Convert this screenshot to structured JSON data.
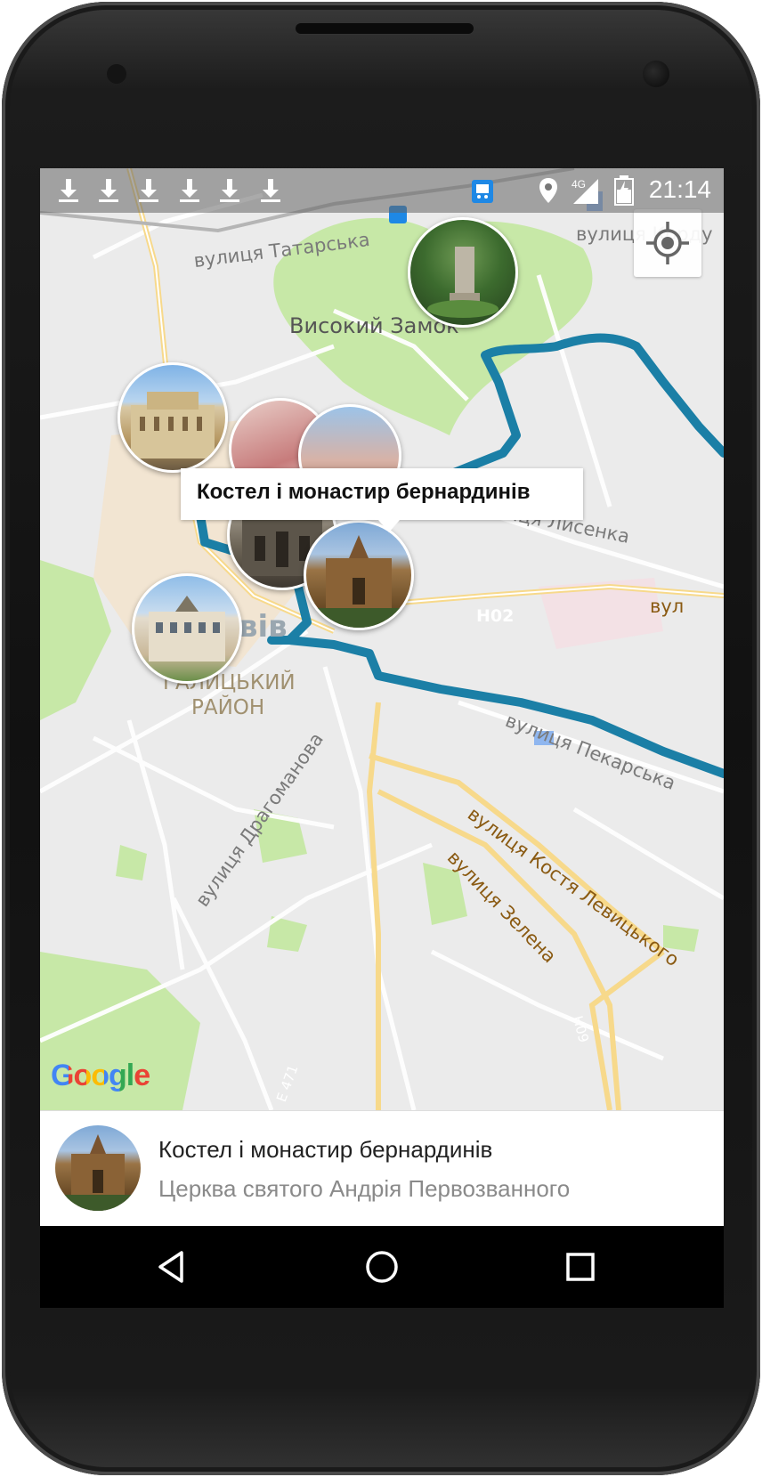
{
  "status_bar": {
    "time": "21:14",
    "network": "4G",
    "download_icons": [
      "download-icon",
      "download-icon",
      "download-icon",
      "download-icon",
      "download-icon",
      "download-icon"
    ]
  },
  "map": {
    "labels": {
      "street_tatarska": "вулиця Татарська",
      "street_kordu": "вулиця Корду",
      "high_castle": "Високий Замок",
      "street_lysenka": "вулиця Лисенка",
      "city_partial": "вів",
      "road_h02": "H02",
      "street_vul": "вул",
      "district_line1": "ГАЛИЦЬКИЙ",
      "district_line2": "РАЙОН",
      "street_pekarska": "вулиця Пекарська",
      "street_drahomanova": "вулиця Драгоманова",
      "street_levytskoho": "вулиця Костя Левицького",
      "street_zelena": "вулиця Зелена",
      "road_e471": "E 471",
      "road_h09": "H09"
    },
    "info_window": "Костел і монастир бернардинів",
    "attribution": "Google"
  },
  "bottom_card": {
    "title": "Костел і монастир бернардинів",
    "subtitle": "Церква святого Андрія Первозванного"
  },
  "colors": {
    "route": "#1b7fa6",
    "park": "#c7e8a7",
    "road_major": "#f7d98b",
    "status_bar": "#6b6b6b"
  }
}
